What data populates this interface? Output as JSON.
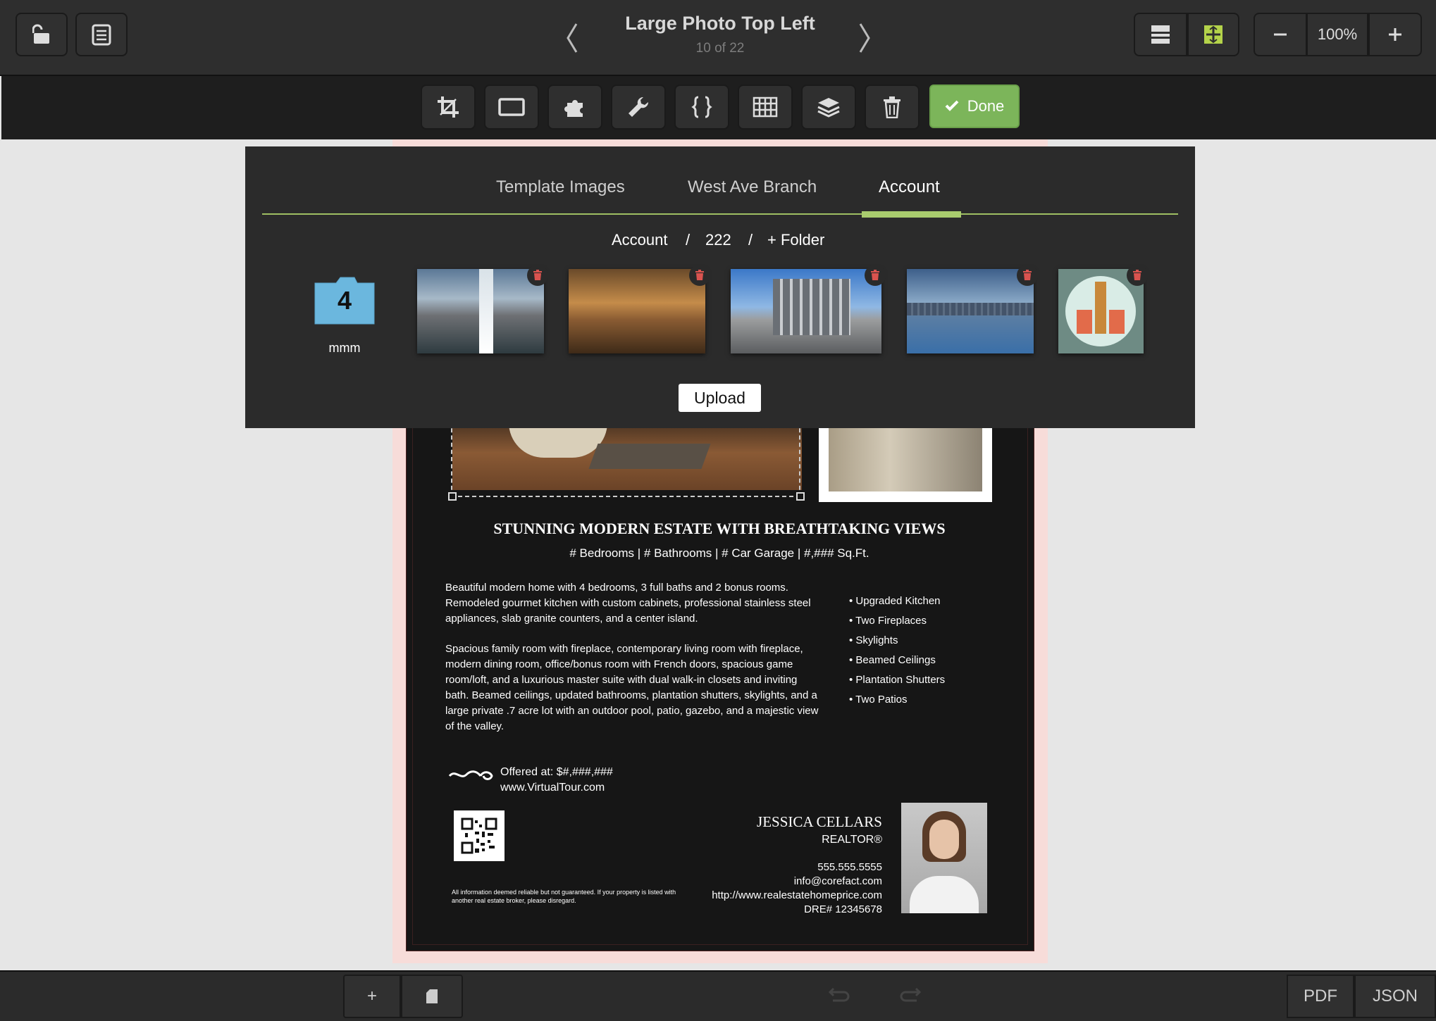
{
  "header": {
    "title": "Large Photo Top Left",
    "page_indicator": "10 of 22",
    "zoom": "100%"
  },
  "toolbar": {
    "done_label": "Done"
  },
  "library": {
    "tabs": [
      "Template Images",
      "West Ave Branch",
      "Account"
    ],
    "active_tab": "Account",
    "breadcrumb": {
      "root": "Account",
      "sep1": "/",
      "folder": "222",
      "sep2": "/",
      "add_folder": "+ Folder"
    },
    "folder": {
      "count": "4",
      "name": "mmm"
    },
    "upload_label": "Upload"
  },
  "flyer": {
    "headline": "STUNNING MODERN ESTATE WITH BREATHTAKING VIEWS",
    "stats": "# Bedrooms | # Bathrooms | # Car Garage | #,### Sq.Ft.",
    "para1": "Beautiful modern home with 4 bedrooms, 3 full baths and 2 bonus rooms. Remodeled gourmet kitchen with custom cabinets, professional stainless steel appliances, slab granite counters, and a center island.",
    "para2": "Spacious family room with fireplace, contemporary living room with fireplace, modern dining room, office/bonus room with French doors, spacious game room/loft, and a luxurious master suite with dual walk-in closets and inviting bath. Beamed ceilings, updated bathrooms, plantation shutters, skylights, and a large private .7 acre lot with an outdoor pool, patio, gazebo, and a majestic view of the valley.",
    "features": [
      "• Upgraded Kitchen",
      "• Two Fireplaces",
      "• Skylights",
      "• Beamed Ceilings",
      "• Plantation Shutters",
      "• Two Patios"
    ],
    "price": "Offered at: $#,###,###",
    "tour_url": "www.VirtualTour.com",
    "agent_name": "JESSICA CELLARS",
    "agent_title": "REALTOR®",
    "phone": "555.555.5555",
    "email": "info@corefact.com",
    "website": "http://www.realestatehomeprice.com",
    "dre": "DRE# 12345678",
    "disclaimer": "All information deemed reliable but not guaranteed. If your property is listed with another real estate broker, please disregard."
  },
  "footer": {
    "add_label": "+",
    "pdf_label": "PDF",
    "json_label": "JSON"
  },
  "colors": {
    "accent_green": "#7cb55a",
    "tab_underline": "#a9cc6e",
    "delete_red": "#d9534f",
    "folder_blue": "#6bb7de"
  }
}
